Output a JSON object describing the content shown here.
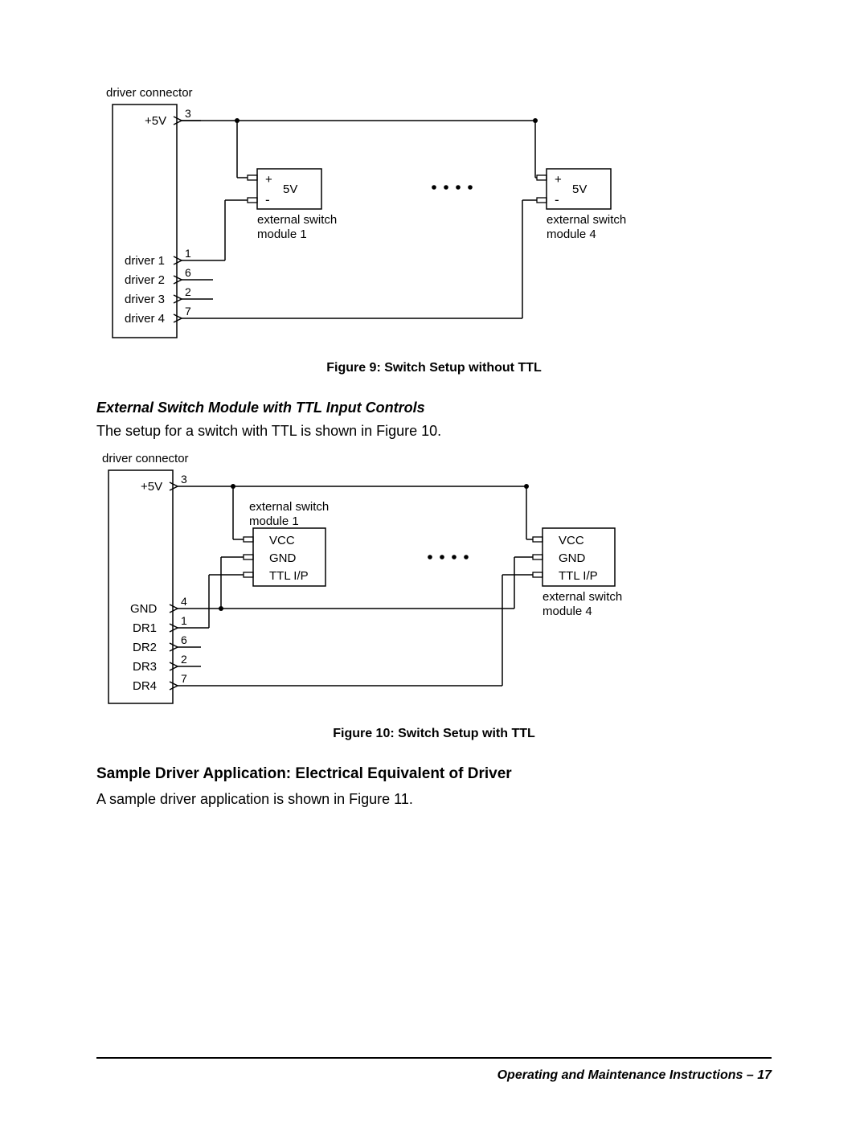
{
  "figure9": {
    "caption": "Figure 9: Switch Setup without TTL",
    "labels": {
      "driver_connector": "driver connector",
      "plus5v": "+5V",
      "pin3": "3",
      "pin1": "1",
      "pin6": "6",
      "pin2": "2",
      "pin7": "7",
      "driver1": "driver 1",
      "driver2": "driver 2",
      "driver3": "driver 3",
      "driver4": "driver 4",
      "plus": "+",
      "minus": "-",
      "five_v": "5V",
      "ext_mod1_l1": "external switch",
      "ext_mod1_l2": "module 1",
      "ext_mod4_l1": "external switch",
      "ext_mod4_l2": "module 4"
    }
  },
  "section1": {
    "title": "External Switch Module with TTL Input Controls",
    "text": "The setup for a switch with TTL is shown in Figure 10."
  },
  "figure10": {
    "caption": "Figure 10: Switch Setup with TTL",
    "labels": {
      "driver_connector": "driver connector",
      "plus5v": "+5V",
      "pin3": "3",
      "pin4": "4",
      "pin1": "1",
      "pin6": "6",
      "pin2": "2",
      "pin7": "7",
      "gnd_label": "GND",
      "dr1": "DR1",
      "dr2": "DR2",
      "dr3": "DR3",
      "dr4": "DR4",
      "vcc": "VCC",
      "gnd": "GND",
      "ttlip": "TTL I/P",
      "ext_mod1_l1": "external switch",
      "ext_mod1_l2": "module 1",
      "ext_mod4_l1": "external switch",
      "ext_mod4_l2": "module 4"
    }
  },
  "section2": {
    "title": "Sample Driver Application: Electrical Equivalent of Driver",
    "text": "A sample driver application is shown in Figure 11."
  },
  "footer": {
    "text": "Operating and Maintenance Instructions  –  17"
  }
}
